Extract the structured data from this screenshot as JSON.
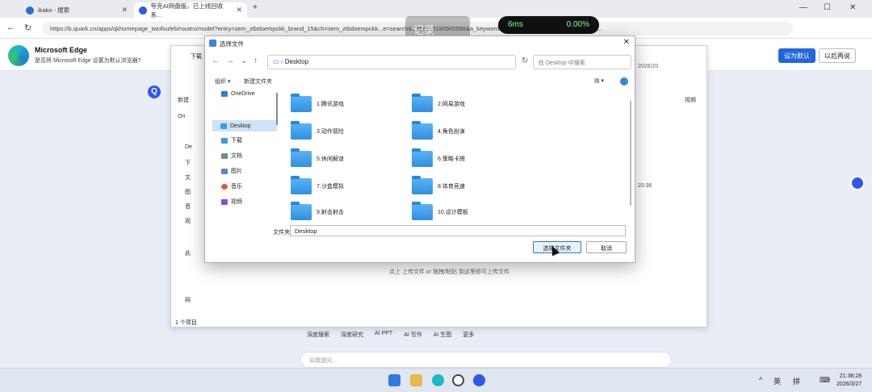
{
  "browser": {
    "tabs": [
      {
        "title": "ikako - 搜索",
        "color": "#2b6fd4"
      },
      {
        "title": "夸克AI网盘版，已上线回收系…",
        "color": "#2f58e8"
      }
    ],
    "new_tab": "+",
    "url": "https://b.quark.cn/apps/qkhomepage_twofoufeb/routes/model?entry=sem_ztbdsempckk_brand_15&ch=sem_ztbdsempckk...e=search&...id=103190900588&a_keywordid=765022223848&a_creative=1325...",
    "window_controls": [
      "—",
      "☐",
      "✕"
    ],
    "nav": [
      "←",
      "→",
      "↻"
    ]
  },
  "infobar": {
    "title": "Microsoft Edge",
    "message": "是否将 Microsoft Edge 设置为默认浏览器?",
    "primary": "设为默认",
    "secondary": "以后再说"
  },
  "overlay": {
    "rec_label": "记录",
    "perf_ms": "6ms",
    "perf_pct": "0.00%"
  },
  "bgwindow": {
    "title": "下载",
    "side_items": [
      "新建",
      "On",
      "De",
      "下",
      "文",
      "图",
      "音",
      "视",
      "此",
      "网"
    ],
    "status": "1 个项目",
    "date": "2026/20",
    "time_label": "20:36",
    "view_label": "视频"
  },
  "dialog": {
    "title": "选择文件",
    "close": "✕",
    "path": "Desktop",
    "search_placeholder": "在 Desktop 中搜索",
    "toolbar": {
      "organize": "组织 ▾",
      "new_folder": "新建文件夹"
    },
    "tree": [
      {
        "label": "OneDrive",
        "color": "#2b7fd4"
      },
      {
        "label": "Desktop",
        "color": "#3a9ae6",
        "selected": true
      },
      {
        "label": "下载",
        "color": "#3a9ae6"
      },
      {
        "label": "文档",
        "color": "#7a8799"
      },
      {
        "label": "图片",
        "color": "#5a86c8"
      },
      {
        "label": "音乐",
        "color": "#e25a3a"
      },
      {
        "label": "视频",
        "color": "#8b4fd6"
      }
    ],
    "folders": [
      "1.腾讯游戏",
      "2.网易游戏",
      "3.动作冒险",
      "4.角色扮演",
      "5.休闲解谜",
      "6.策略卡牌",
      "7.沙盒模拟",
      "8.体育竞速",
      "9.射击射击",
      "10.设计模板"
    ],
    "filename_label": "文件夹:",
    "filename_value": "Desktop",
    "select_button": "选择文件夹",
    "cancel_button": "取消"
  },
  "page": {
    "upload_hint": "点上 上传文件 or 拖拽/粘贴 到这里即可上传文件",
    "upload_link": "上传文件",
    "tools": [
      "深度搜索",
      "深度研究",
      "AI PPT",
      "AI 写作",
      "AI 生图",
      "更多"
    ],
    "ask_placeholder": "向我提问…"
  },
  "taskbar": {
    "tray": [
      "^",
      "英",
      "拼",
      "⌨"
    ],
    "time": "21:38:28",
    "date": "2026/3/27"
  }
}
